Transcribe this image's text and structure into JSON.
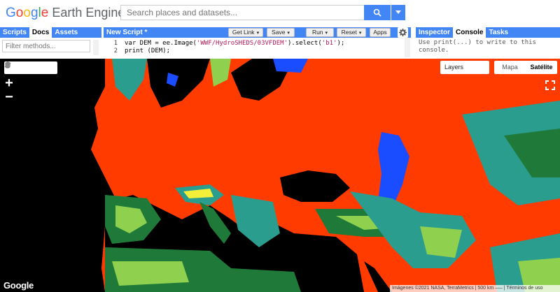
{
  "logo": {
    "g": "G",
    "o1": "o",
    "o2": "o",
    "g2": "g",
    "l": "l",
    "e": "e",
    "rest": " Earth Engine"
  },
  "search": {
    "placeholder": "Search places and datasets..."
  },
  "left_panel": {
    "tabs": [
      "Scripts",
      "Docs",
      "Assets"
    ],
    "active_tab": "Docs",
    "filter_placeholder": "Filter methods..."
  },
  "editor": {
    "title": "New Script *",
    "buttons": {
      "get_link": "Get Link",
      "save": "Save",
      "run": "Run",
      "reset": "Reset",
      "apps": "Apps"
    },
    "lines": [
      {
        "n": "1",
        "pre": "var DEM = ee.Image(",
        "str": "'WWF/HydroSHEDS/03VFDEM'",
        "mid": ").select(",
        "str2": "'b1'",
        "post": ");"
      },
      {
        "n": "2",
        "pre": "print (DEM);",
        "str": "",
        "mid": "",
        "str2": "",
        "post": ""
      }
    ]
  },
  "right_panel": {
    "tabs": [
      "Inspector",
      "Console",
      "Tasks"
    ],
    "active_tab": "Console",
    "console_text": "Use print(...) to write to this console."
  },
  "map": {
    "layers_label": "Layers",
    "map_types": [
      "Mapa",
      "Satélite"
    ],
    "selected_map_type": "Satélite",
    "zoom_in": "+",
    "zoom_out": "−",
    "google_logo": "Google",
    "attribution": "Imágenes ©2021 NASA, TerraMetrics | 500 km ⎯⎯⎯ | Términos de uso",
    "colors": {
      "sea": "#000000",
      "low": "#ff3b00",
      "lakes": "#1a4dff",
      "mid1": "#2a9d8f",
      "mid2": "#1f7a3a",
      "high1": "#8fd14f",
      "high2": "#f2ef3a"
    }
  },
  "icons": [
    "search-icon",
    "chevron-down-icon",
    "gear-icon",
    "hand-icon",
    "marker-icon",
    "line-icon",
    "polygon-icon",
    "rectangle-icon",
    "fullscreen-icon"
  ]
}
